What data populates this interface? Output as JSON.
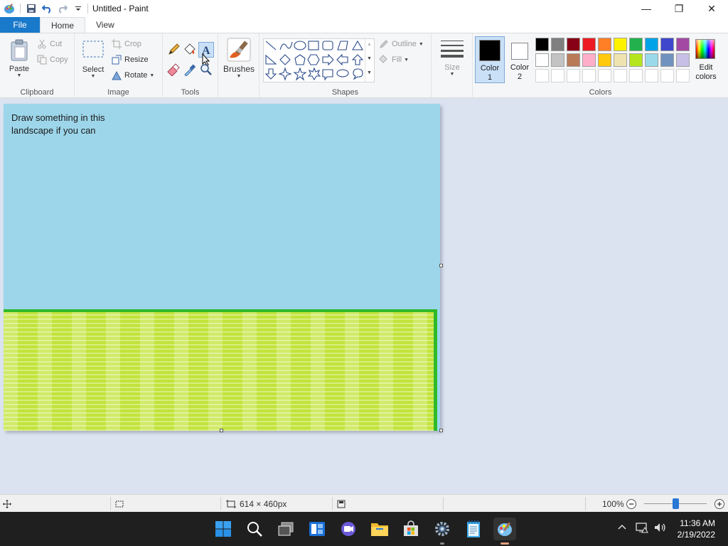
{
  "window": {
    "title": "Untitled - Paint",
    "minimize": "—",
    "restore": "❐",
    "close": "✕"
  },
  "tabs": {
    "file": "File",
    "home": "Home",
    "view": "View"
  },
  "clipboard": {
    "label": "Clipboard",
    "paste": "Paste",
    "cut": "Cut",
    "copy": "Copy"
  },
  "image": {
    "label": "Image",
    "select": "Select",
    "crop": "Crop",
    "resize": "Resize",
    "rotate": "Rotate"
  },
  "tools": {
    "label": "Tools"
  },
  "brushes": {
    "label": "Brushes"
  },
  "shapes": {
    "label": "Shapes",
    "outline": "Outline",
    "fill": "Fill"
  },
  "size": {
    "label": "Size"
  },
  "colors": {
    "label": "Colors",
    "color1": "Color",
    "color1_num": "1",
    "color2": "Color",
    "color2_num": "2",
    "edit": "Edit",
    "edit2": "colors",
    "color1_value": "#000000",
    "color2_value": "#ffffff",
    "row1": [
      "#000000",
      "#7f7f7f",
      "#880015",
      "#ed1c24",
      "#ff7f27",
      "#fff200",
      "#22b14c",
      "#00a2e8",
      "#3f48cc",
      "#a349a4"
    ],
    "row2": [
      "#ffffff",
      "#c3c3c3",
      "#b97a57",
      "#ffaec9",
      "#ffc90e",
      "#efe4b0",
      "#b5e61d",
      "#99d9ea",
      "#7092be",
      "#c8bfe7"
    ]
  },
  "canvas": {
    "text_line1": "Draw something in this",
    "text_line2": "landscape if you can",
    "sky_color": "#9dd6ea",
    "grass_color": "#c2e33a",
    "border_green": "#2fba2a"
  },
  "status": {
    "dimensions": "614 × 460px",
    "zoom": "100%",
    "zoom_level": 0.5
  },
  "taskbar": {
    "time": "11:36 AM",
    "date": "2/19/2022"
  }
}
